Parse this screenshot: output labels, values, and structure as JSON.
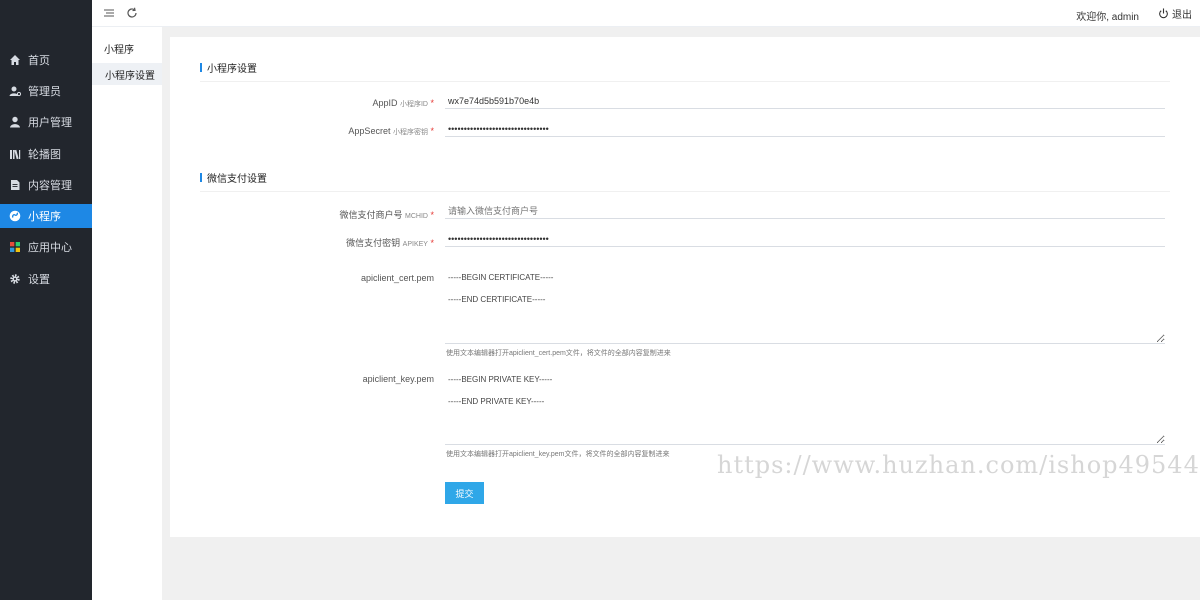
{
  "sidebar": {
    "items": [
      {
        "label": "首页",
        "icon": "home-icon"
      },
      {
        "label": "管理员",
        "icon": "admin-icon"
      },
      {
        "label": "用户管理",
        "icon": "user-icon"
      },
      {
        "label": "轮播图",
        "icon": "carousel-icon"
      },
      {
        "label": "内容管理",
        "icon": "document-icon"
      },
      {
        "label": "小程序",
        "icon": "miniprogram-icon",
        "active": true
      },
      {
        "label": "应用中心",
        "icon": "apps-icon"
      },
      {
        "label": "设置",
        "icon": "gear-icon"
      }
    ]
  },
  "topbar": {
    "welcome": "欢迎你, admin",
    "logout_label": "退出",
    "menu_icon": "menu-icon",
    "refresh_icon": "refresh-icon"
  },
  "subnav": {
    "title": "小程序",
    "items": [
      {
        "label": "小程序设置",
        "active": true
      }
    ]
  },
  "form": {
    "section1_title": "小程序设置",
    "appid": {
      "label": "AppID",
      "sub": "小程序ID",
      "required": "*",
      "value": "wx7e74d5b591b70e4b"
    },
    "appsecret": {
      "label": "AppSecret",
      "sub": "小程序密钥",
      "required": "*",
      "value": "••••••••••••••••••••••••••••••••"
    },
    "section2_title": "微信支付设置",
    "mchid": {
      "label": "微信支付商户号",
      "sub": "MCHID",
      "required": "*",
      "value": "",
      "placeholder": "请输入微信支付商户号"
    },
    "apikey": {
      "label": "微信支付密钥",
      "sub": "APIKEY",
      "required": "*",
      "value": "••••••••••••••••••••••••••••••••"
    },
    "cert": {
      "label": "apiclient_cert.pem",
      "value": "-----BEGIN CERTIFICATE-----\n-----END CERTIFICATE-----",
      "hint": "使用文本编辑器打开apiclient_cert.pem文件，将文件的全部内容复制进来"
    },
    "key": {
      "label": "apiclient_key.pem",
      "value": "-----BEGIN PRIVATE KEY-----\n-----END PRIVATE KEY-----",
      "hint": "使用文本编辑器打开apiclient_key.pem文件，将文件的全部内容复制进来"
    },
    "submit_label": "提交"
  },
  "watermark": "https://www.huzhan.com/ishop49544",
  "colors": {
    "sidebar_bg": "#22262d",
    "accent": "#1e88e5",
    "button": "#2fa7e8",
    "required": "#e53935"
  }
}
